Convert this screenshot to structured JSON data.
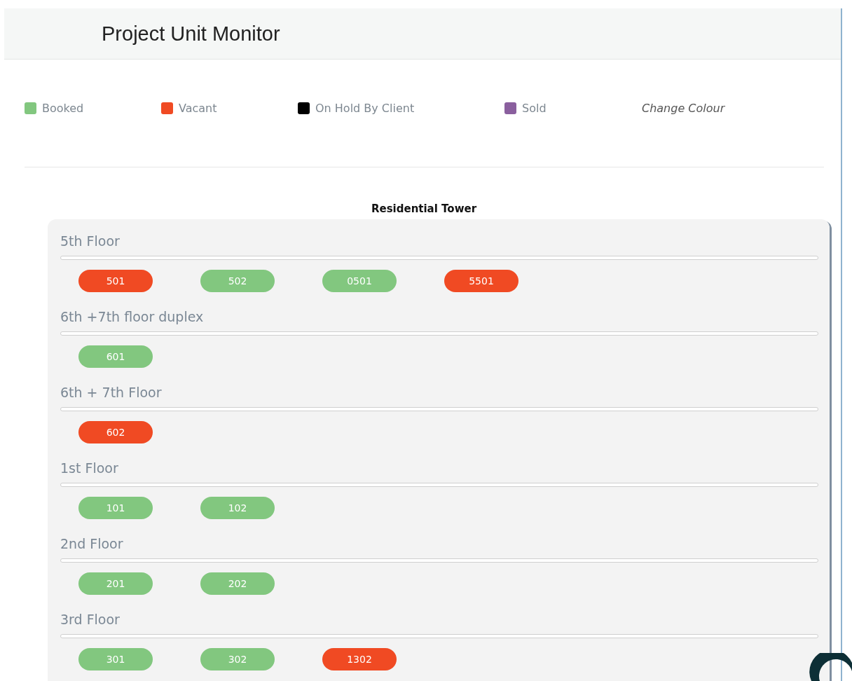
{
  "title": "Project Unit Monitor",
  "legend": [
    {
      "label": "Booked",
      "color": "#82c77f"
    },
    {
      "label": "Vacant",
      "color": "#f04a23"
    },
    {
      "label": "On Hold By Client",
      "color": "#000000"
    },
    {
      "label": "Sold",
      "color": "#8a5f9e"
    }
  ],
  "change_colour": "Change Colour",
  "tower": {
    "title": "Residential Tower",
    "floors": [
      {
        "name": "5th Floor",
        "units": [
          {
            "label": "501",
            "color": "#f04a23"
          },
          {
            "label": "502",
            "color": "#82c77f"
          },
          {
            "label": "0501",
            "color": "#82c77f"
          },
          {
            "label": "5501",
            "color": "#f04a23"
          }
        ]
      },
      {
        "name": "6th +7th floor duplex",
        "units": [
          {
            "label": "601",
            "color": "#82c77f"
          }
        ]
      },
      {
        "name": "6th + 7th Floor",
        "units": [
          {
            "label": "602",
            "color": "#f04a23"
          }
        ]
      },
      {
        "name": "1st Floor",
        "units": [
          {
            "label": "101",
            "color": "#82c77f"
          },
          {
            "label": "102",
            "color": "#82c77f"
          }
        ]
      },
      {
        "name": "2nd Floor",
        "units": [
          {
            "label": "201",
            "color": "#82c77f"
          },
          {
            "label": "202",
            "color": "#82c77f"
          }
        ]
      },
      {
        "name": "3rd Floor",
        "units": [
          {
            "label": "301",
            "color": "#82c77f"
          },
          {
            "label": "302",
            "color": "#82c77f"
          },
          {
            "label": "1302",
            "color": "#f04a23"
          }
        ]
      }
    ]
  }
}
